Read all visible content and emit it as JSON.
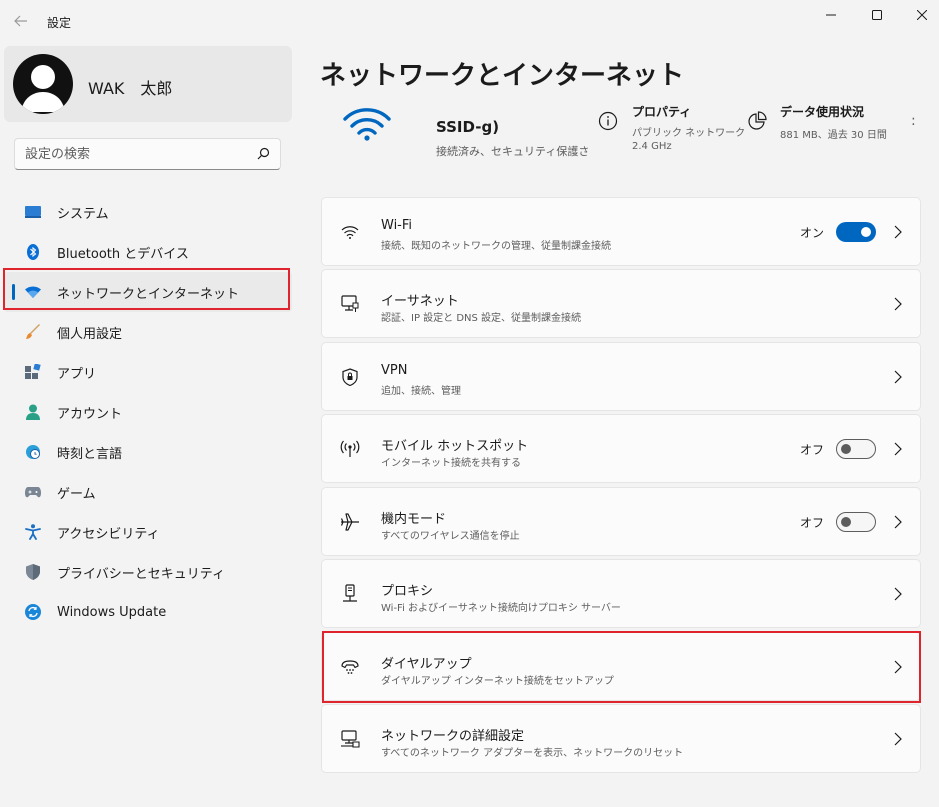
{
  "window": {
    "title": "設定"
  },
  "profile": {
    "name": "WAK　太郎"
  },
  "search": {
    "placeholder": "設定の検索"
  },
  "sidebar": {
    "items": [
      {
        "label": "システム",
        "icon": "system-icon"
      },
      {
        "label": "Bluetooth とデバイス",
        "icon": "bluetooth-icon"
      },
      {
        "label": "ネットワークとインターネット",
        "icon": "wifi-icon",
        "active": true
      },
      {
        "label": "個人用設定",
        "icon": "brush-icon"
      },
      {
        "label": "アプリ",
        "icon": "apps-icon"
      },
      {
        "label": "アカウント",
        "icon": "account-icon"
      },
      {
        "label": "時刻と言語",
        "icon": "globe-clock-icon"
      },
      {
        "label": "ゲーム",
        "icon": "gamepad-icon"
      },
      {
        "label": "アクセシビリティ",
        "icon": "accessibility-icon"
      },
      {
        "label": "プライバシーとセキュリティ",
        "icon": "shield-icon"
      },
      {
        "label": "Windows Update",
        "icon": "update-icon"
      }
    ]
  },
  "main": {
    "title": "ネットワークとインターネット",
    "network": {
      "ssid": "SSID-g)",
      "status": "接続済み、セキュリティ保護さ"
    },
    "properties": {
      "title": "プロパティ",
      "line1": "パブリック ネットワーク",
      "line2": "2.4 GHz"
    },
    "data_usage": {
      "title": "データ使用状況",
      "line1": "881 MB、過去 30 日間"
    },
    "more": ":",
    "cards": [
      {
        "title": "Wi-Fi",
        "subtitle": "接続、既知のネットワークの管理、従量制課金接続",
        "toggle": "on",
        "toggle_label": "オン",
        "icon": "wifi-icon"
      },
      {
        "title": "イーサネット",
        "subtitle": "認証、IP 設定と DNS 設定、従量制課金接続",
        "icon": "ethernet-icon"
      },
      {
        "title": "VPN",
        "subtitle": "追加、接続、管理",
        "icon": "vpn-shield-icon"
      },
      {
        "title": "モバイル ホットスポット",
        "subtitle": "インターネット接続を共有する",
        "toggle": "off",
        "toggle_label": "オフ",
        "icon": "hotspot-icon"
      },
      {
        "title": "機内モード",
        "subtitle": "すべてのワイヤレス通信を停止",
        "toggle": "off",
        "toggle_label": "オフ",
        "icon": "airplane-icon"
      },
      {
        "title": "プロキシ",
        "subtitle": "Wi-Fi およびイーサネット接続向けプロキシ サーバー",
        "icon": "proxy-icon"
      },
      {
        "title": "ダイヤルアップ",
        "subtitle": "ダイヤルアップ インターネット接続をセットアップ",
        "icon": "dialup-icon"
      },
      {
        "title": "ネットワークの詳細設定",
        "subtitle": "すべてのネットワーク アダプターを表示、ネットワークのリセット",
        "icon": "network-monitor-icon"
      }
    ]
  },
  "colors": {
    "accent": "#0067c0",
    "highlight": "#e0242e",
    "background": "#f3f3f3",
    "card": "#fbfbfb"
  }
}
